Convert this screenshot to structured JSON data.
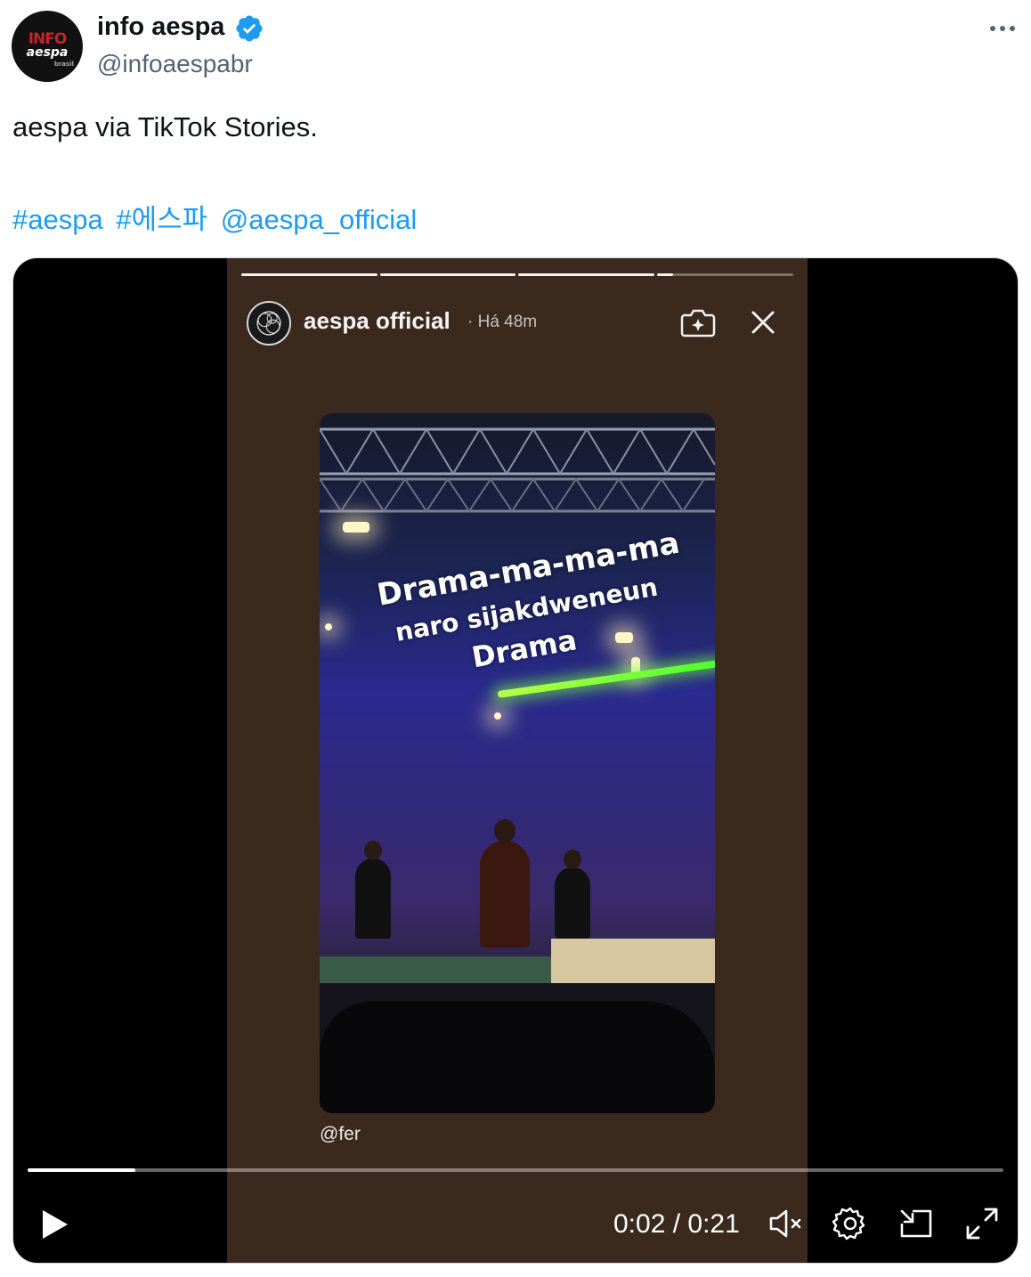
{
  "author": {
    "display_name": "info aespa",
    "handle": "@infoaespabr",
    "avatar_text_top": "INFO",
    "avatar_text_mid": "aespa",
    "avatar_text_small": "brasil"
  },
  "tweet": {
    "text": "aespa via TikTok Stories.",
    "hashtags": [
      "#aespa",
      "#에스파",
      "@aespa_official"
    ]
  },
  "story": {
    "account_name": "aespa official",
    "time_ago": "· Há 48m",
    "progress_segments": [
      1.0,
      1.0,
      1.0,
      0.12
    ],
    "lyrics": [
      "Drama-ma-ma-ma",
      "naro sijakdweneun",
      "Drama"
    ],
    "credit": "@fer"
  },
  "player": {
    "time_display": "0:02 / 0:21",
    "progress": 0.11,
    "muted": true
  },
  "colors": {
    "link": "#1d9bf0",
    "verified": "#1d9bf0",
    "secondary_text": "#536471"
  }
}
